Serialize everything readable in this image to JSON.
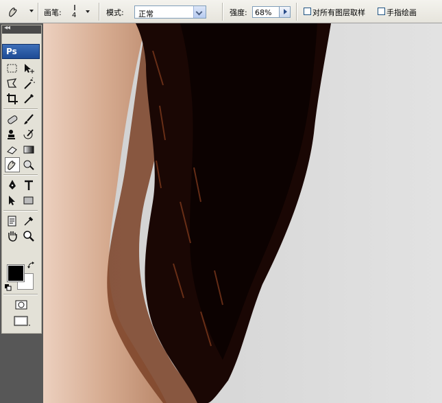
{
  "options_bar": {
    "tool_icon": "smudge-finger-icon",
    "brush_label": "画笔:",
    "brush_size": "4",
    "mode_label": "模式:",
    "mode_value": "正常",
    "strength_label": "强度:",
    "strength_value": "68%",
    "sample_all_layers_label": "对所有图层取样",
    "sample_all_layers_checked": false,
    "finger_painting_label": "手指绘画",
    "finger_painting_checked": false
  },
  "toolbox": {
    "collapse_label": "◂◂",
    "logo_label": "Ps",
    "foreground_color": "#000000",
    "background_color": "#ffffff",
    "tools": [
      "marquee-icon",
      "move-icon",
      "lasso-icon",
      "magic-wand-icon",
      "crop-icon",
      "eyedropper-slice-icon",
      "healing-brush-icon",
      "brush-icon",
      "clone-stamp-icon",
      "history-brush-icon",
      "eraser-icon",
      "gradient-icon",
      "smudge-icon",
      "dodge-icon",
      "pen-icon",
      "type-icon",
      "path-select-icon",
      "shape-icon",
      "notes-icon",
      "eyedropper-icon",
      "hand-icon",
      "zoom-icon"
    ],
    "active_tool": "smudge-icon"
  },
  "canvas": {
    "description_colors": {
      "skin": "#d9ae92",
      "hair": "#120402",
      "background": "#dedede"
    }
  }
}
